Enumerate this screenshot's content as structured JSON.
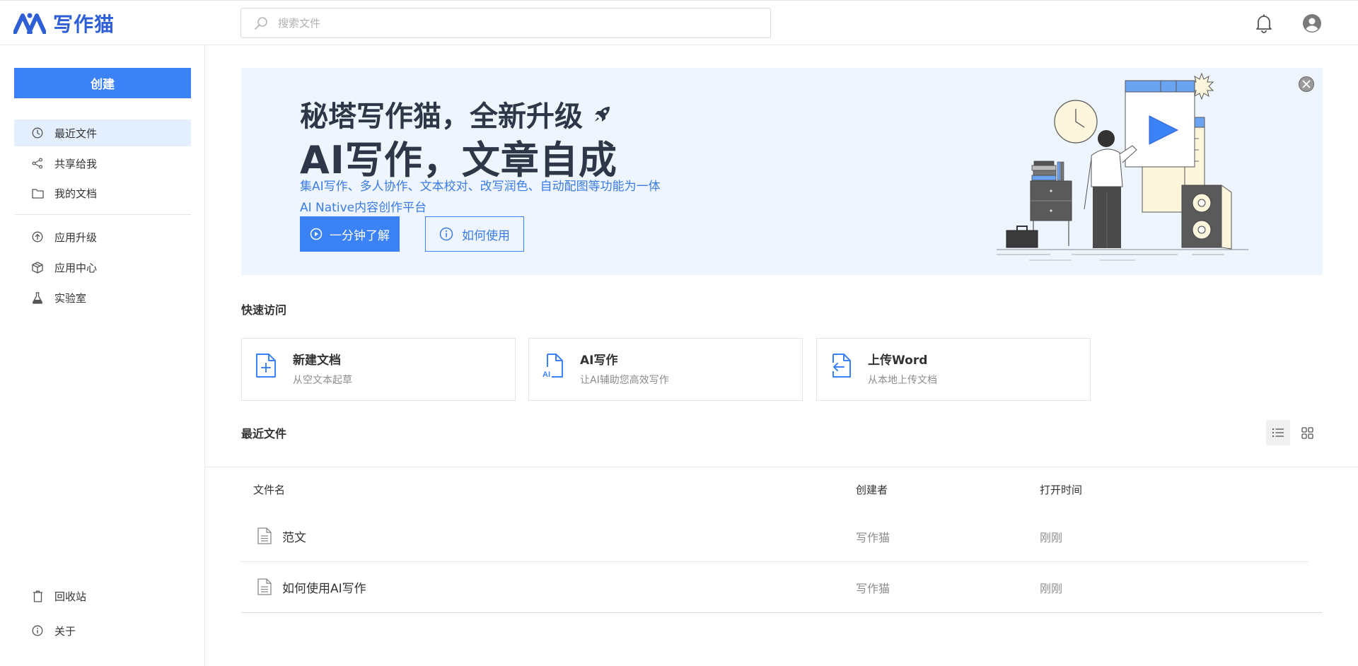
{
  "app": {
    "name": "写作猫",
    "brand_color": "#2f5fd6",
    "accent": "#3b82f6"
  },
  "header": {
    "search_placeholder": "搜索文件",
    "icons": [
      "search-icon",
      "bell-icon",
      "user-avatar-icon"
    ]
  },
  "sidebar": {
    "create_label": "创建",
    "items": [
      {
        "label": "最近文件",
        "icon": "clock-icon",
        "active": true
      },
      {
        "label": "共享给我",
        "icon": "share-icon"
      },
      {
        "label": "我的文档",
        "icon": "folder-icon"
      },
      {
        "label": "应用升级",
        "icon": "upgrade-icon"
      },
      {
        "label": "应用中心",
        "icon": "cube-icon"
      },
      {
        "label": "实验室",
        "icon": "flask-icon"
      }
    ],
    "bottom": [
      {
        "label": "回收站",
        "icon": "trash-icon"
      },
      {
        "label": "关于",
        "icon": "info-icon"
      }
    ]
  },
  "banner": {
    "title1": "秘塔写作猫，全新升级",
    "title2": "AI写作，文章自成",
    "sub1": "集AI写作、多人协作、文本校对、改写润色、自动配图等功能为一体",
    "sub2": "AI Native内容创作平台",
    "btn_primary": "一分钟了解",
    "btn_secondary": "如何使用",
    "bg_color": "#eef5fe"
  },
  "quick_access": {
    "title": "快速访问",
    "cards": [
      {
        "title": "新建文档",
        "desc": "从空文本起草",
        "icon": "new-doc-icon"
      },
      {
        "title": "AI写作",
        "desc": "让AI辅助您高效写作",
        "icon": "ai-doc-icon"
      },
      {
        "title": "上传Word",
        "desc": "从本地上传文档",
        "icon": "upload-doc-icon"
      }
    ]
  },
  "recent": {
    "title": "最近文件",
    "view_mode": "list",
    "columns": [
      "文件名",
      "创建者",
      "打开时间"
    ],
    "rows": [
      {
        "name": "范文",
        "creator": "写作猫",
        "time": "刚刚"
      },
      {
        "name": "如何使用AI写作",
        "creator": "写作猫",
        "time": "刚刚"
      }
    ]
  }
}
